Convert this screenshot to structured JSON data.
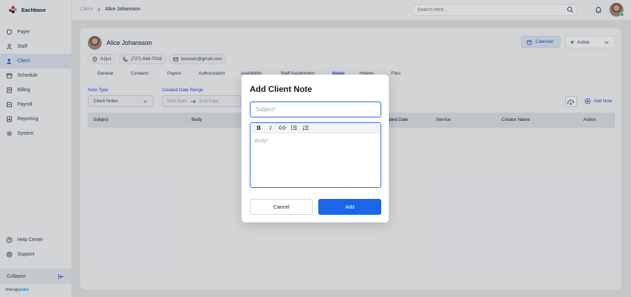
{
  "brand": {
    "name": "Eachbase",
    "footer_a": "therapy",
    "footer_b": "lake"
  },
  "sidebar": {
    "items": [
      {
        "label": "Payer",
        "icon": "shield-icon"
      },
      {
        "label": "Staff",
        "icon": "user-icon"
      },
      {
        "label": "Client",
        "icon": "client-icon",
        "active": true
      },
      {
        "label": "Schedule",
        "icon": "calendar-icon"
      },
      {
        "label": "Billing",
        "icon": "billing-icon"
      },
      {
        "label": "Payroll",
        "icon": "payroll-icon"
      },
      {
        "label": "Reporting",
        "icon": "reporting-icon"
      },
      {
        "label": "System",
        "icon": "gear-icon"
      }
    ],
    "bottom": [
      {
        "label": "Help Center",
        "icon": "help-icon"
      },
      {
        "label": "Support",
        "icon": "support-icon"
      }
    ],
    "collapse_label": "Collapse"
  },
  "header": {
    "breadcrumb_root": "Client",
    "breadcrumb_current": "Alice Johansson",
    "search_placeholder": "Search here..."
  },
  "client": {
    "name": "Alice Johansson",
    "id": "AJjo1",
    "phone": "(727) 644-7018",
    "email": "testuser@gmail.com",
    "calendar_label": "Calendar",
    "status": "Active",
    "status_color": "#22c55e"
  },
  "tabs": [
    "General",
    "Contacts",
    "Payers",
    "Authorization",
    "Availability",
    "Staff Assignment",
    "Notes",
    "History",
    "Files"
  ],
  "active_tab": "Notes",
  "filters": {
    "note_type_label": "Note Type",
    "note_type_value": "Client Notes",
    "date_range_label": "Created Date Range",
    "start_placeholder": "Start Date",
    "end_placeholder": "End Date",
    "add_note_label": "Add Note"
  },
  "table": {
    "columns": [
      "Subject",
      "Body",
      "Created Date",
      "Service",
      "Creator Name",
      "Action"
    ]
  },
  "modal": {
    "title": "Add Client Note",
    "subject_placeholder": "Subject*",
    "body_placeholder": "Body*",
    "toolbar": [
      "B",
      "I"
    ],
    "cancel_label": "Cancel",
    "add_label": "Add",
    "accent": "#1a66e8"
  }
}
